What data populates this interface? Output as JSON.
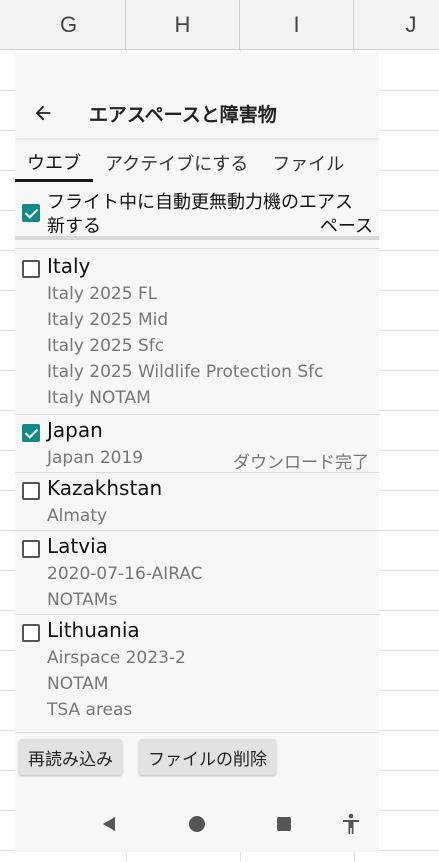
{
  "spreadsheet": {
    "columns": [
      "G",
      "H",
      "I",
      "J"
    ]
  },
  "app": {
    "title": "エアスペースと障害物",
    "tabs": [
      "ウエブ",
      "アクテイブにする",
      "ファイル"
    ],
    "auto_update": {
      "line1": "フライト中に自動更無動力機のエアス",
      "line2a": "新する",
      "line2b": "ペース",
      "checked": true
    },
    "countries": [
      {
        "name": "Italy",
        "checked": false,
        "items": [
          "Italy 2025 FL",
          "Italy 2025 Mid",
          "Italy 2025 Sfc",
          "Italy 2025 Wildlife Protection Sfc",
          "Italy NOTAM"
        ]
      },
      {
        "name": "Japan",
        "checked": true,
        "items": [
          "Japan 2019"
        ],
        "status": "ダウンロード完了"
      },
      {
        "name": "Kazakhstan",
        "checked": false,
        "items": [
          "Almaty"
        ]
      },
      {
        "name": "Latvia",
        "checked": false,
        "items": [
          "2020-07-16-AIRAC",
          "NOTAMs"
        ]
      },
      {
        "name": "Lithuania",
        "checked": false,
        "items": [
          "Airspace 2023-2",
          "NOTAM",
          "TSA areas"
        ]
      }
    ],
    "buttons": {
      "reload": "再読み込み",
      "delete_files": "ファイルの削除"
    },
    "colors": {
      "accent": "#138a83"
    }
  }
}
